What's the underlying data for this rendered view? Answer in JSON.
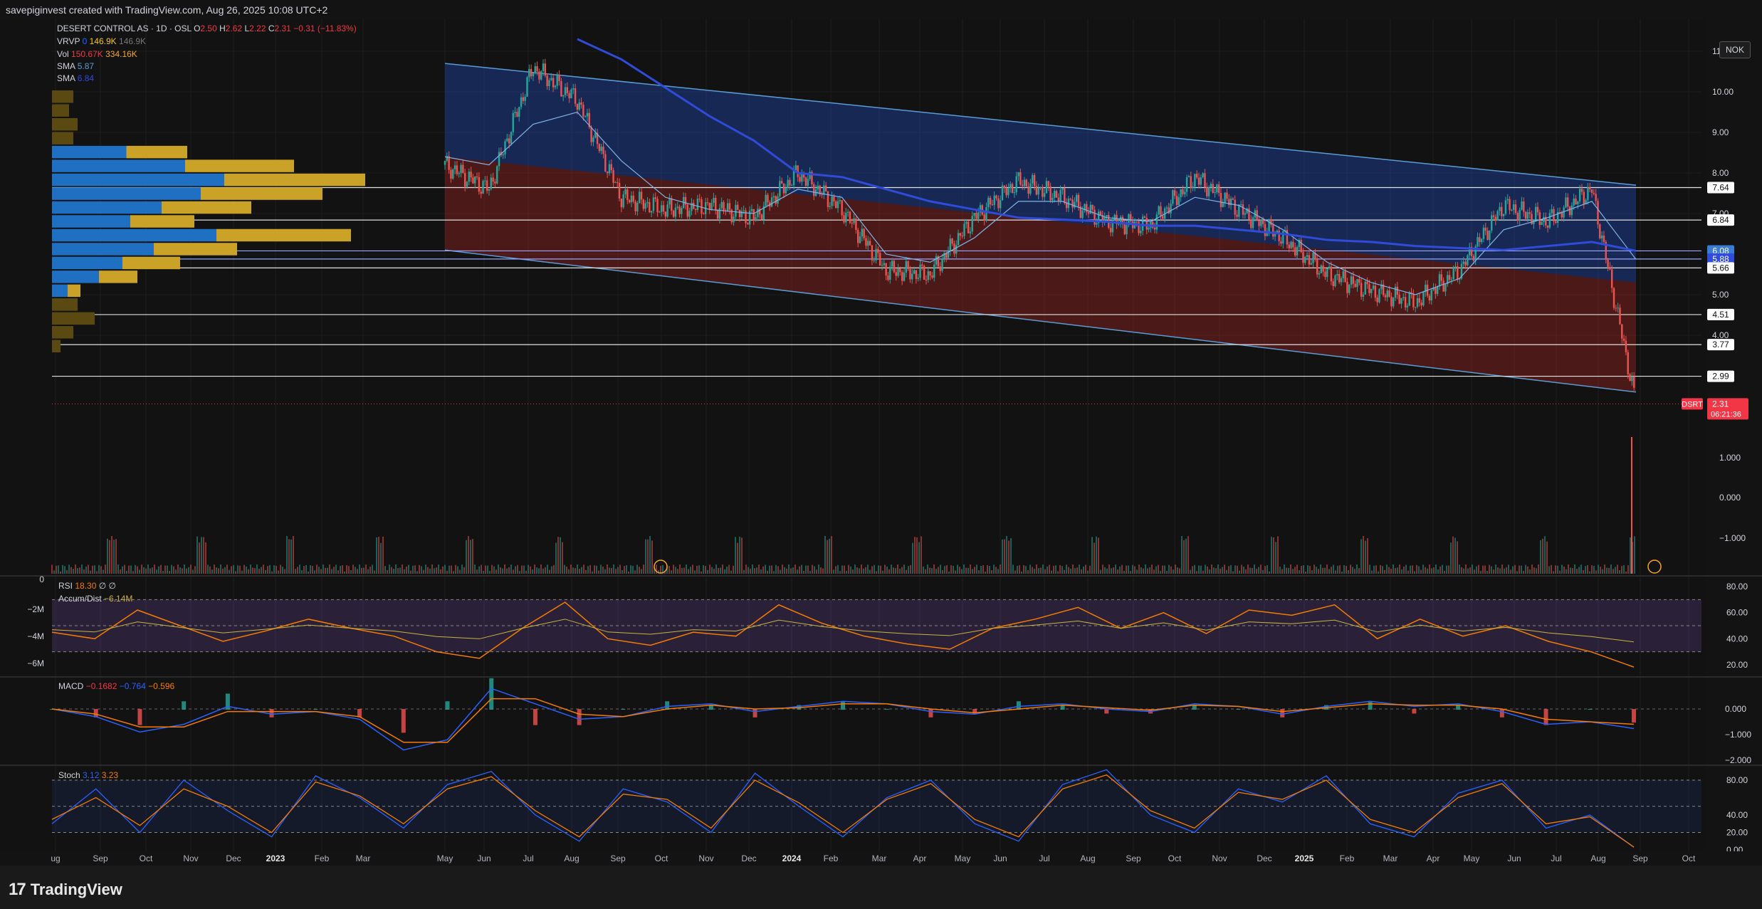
{
  "header": {
    "credit": "savepiginvest created with TradingView.com, Aug 26, 2025 10:08 UTC+2"
  },
  "currency_button": "NOK",
  "footer": {
    "logo_text": "TradingView"
  },
  "legend": {
    "title": "DESERT CONTROL AS · 1D · OSL",
    "ohlc": [
      {
        "k": "O",
        "v": "2.50"
      },
      {
        "k": "H",
        "v": "2.62"
      },
      {
        "k": "L",
        "v": "2.22"
      },
      {
        "k": "C",
        "v": "2.31"
      }
    ],
    "change": "−0.31 (−11.83%)",
    "vrvp": {
      "name": "VRVP",
      "a": "0",
      "b": "146.9K",
      "c": "146.9K"
    },
    "vol": {
      "name": "Vol",
      "a": "150.67K",
      "b": "334.16K"
    },
    "sma1": {
      "name": "SMA",
      "v": "5.87"
    },
    "sma2": {
      "name": "SMA",
      "v": "6.84"
    },
    "rsi": {
      "name": "RSI",
      "a": "18.30",
      "b": "∅",
      "c": "∅"
    },
    "accum": {
      "name": "Accum/Dist",
      "v": "−6.14M"
    },
    "macd": {
      "name": "MACD",
      "a": "−0.1682",
      "b": "−0.764",
      "c": "−0.596"
    },
    "stoch": {
      "name": "Stoch",
      "a": "3.12",
      "b": "3.23"
    }
  },
  "chart_data": [
    {
      "type": "line",
      "title": "DESERT CONTROL AS · 1D · OSL",
      "ticker": "DSRT",
      "last_price": "2.31",
      "countdown": "06:21:36",
      "x_axis_labels": [
        "ug",
        "Sep",
        "Oct",
        "Nov",
        "Dec",
        "2023",
        "Feb",
        "Mar",
        "May",
        "Jun",
        "Jul",
        "Aug",
        "Sep",
        "Oct",
        "Nov",
        "Dec",
        "2024",
        "Feb",
        "Mar",
        "Apr",
        "May",
        "Jun",
        "Jul",
        "Aug",
        "Sep",
        "Oct",
        "Nov",
        "Dec",
        "2025",
        "Feb",
        "Mar",
        "Apr",
        "May",
        "Jun",
        "Jul",
        "Aug",
        "Sep",
        "Oct"
      ],
      "y_ticks": [
        "11.00",
        "10.00",
        "9.00",
        "8.00",
        "7.00",
        "6.00",
        "5.00",
        "4.00"
      ],
      "horizontal_levels": [
        "7.64",
        "6.84",
        "6.08",
        "5.88",
        "5.66",
        "4.51",
        "3.77",
        "2.99"
      ],
      "channel": {
        "upper": [
          10.7,
          7.7
        ],
        "lower": [
          6.1,
          2.6
        ],
        "mid": [
          8.4,
          5.3
        ],
        "from": "2023-05",
        "to": "2025-08"
      },
      "price_series": {
        "x": [
          "2023-05",
          "2023-06",
          "2023-07",
          "2023-08",
          "2023-09",
          "2023-10",
          "2023-11",
          "2023-12",
          "2024-01",
          "2024-02",
          "2024-03",
          "2024-04",
          "2024-05",
          "2024-06",
          "2024-07",
          "2024-08",
          "2024-09",
          "2024-10",
          "2024-11",
          "2024-12",
          "2025-01",
          "2025-02",
          "2025-03",
          "2025-04",
          "2025-05",
          "2025-06",
          "2025-07",
          "2025-08"
        ],
        "close": [
          8.2,
          7.6,
          10.6,
          9.8,
          7.4,
          7.1,
          7.2,
          6.9,
          8.0,
          7.1,
          5.6,
          5.5,
          6.9,
          7.8,
          7.4,
          6.8,
          6.7,
          7.9,
          7.1,
          6.4,
          5.5,
          5.1,
          4.8,
          5.6,
          7.2,
          6.8,
          7.6,
          2.31
        ]
      },
      "sma_fast": [
        8.4,
        8.2,
        9.2,
        9.5,
        8.3,
        7.4,
        7.1,
        7.0,
        7.6,
        7.4,
        6.0,
        5.8,
        6.4,
        7.3,
        7.3,
        6.9,
        6.8,
        7.4,
        7.2,
        6.6,
        5.8,
        5.3,
        5.0,
        5.4,
        6.6,
        6.9,
        7.3,
        5.87
      ],
      "sma_slow": [
        null,
        null,
        null,
        11.3,
        10.8,
        10.1,
        9.4,
        8.8,
        8.0,
        7.9,
        7.6,
        7.3,
        7.1,
        6.9,
        6.85,
        6.8,
        6.7,
        6.7,
        6.6,
        6.5,
        6.35,
        6.3,
        6.2,
        6.15,
        6.1,
        6.2,
        6.3,
        6.08
      ],
      "volume_profile": [
        0.25,
        0.2,
        0.3,
        0.25,
        0.95,
        1.7,
        2.2,
        1.9,
        1.4,
        1.0,
        2.1,
        1.3,
        0.9,
        0.6,
        0.2,
        0.3,
        0.5,
        0.25,
        0.1
      ],
      "volume_axis_ticks": [
        "1.000",
        "0.000",
        "−1.000"
      ]
    },
    {
      "type": "line",
      "title": "RSI",
      "y_ticks": [
        "80.00",
        "60.00",
        "40.00",
        "20.00"
      ],
      "accum_ticks": [
        "0",
        "−2M",
        "−4M",
        "−6M"
      ],
      "values": [
        45,
        40,
        62,
        50,
        38,
        46,
        55,
        48,
        42,
        30,
        25,
        48,
        68,
        40,
        35,
        45,
        42,
        66,
        52,
        42,
        36,
        32,
        48,
        55,
        64,
        48,
        60,
        44,
        62,
        58,
        66,
        40,
        55,
        42,
        50,
        38,
        30,
        18.3
      ]
    },
    {
      "type": "line",
      "title": "MACD",
      "y_ticks": [
        "0.000",
        "−1.000",
        "−2.000"
      ],
      "macd": [
        0.0,
        -0.3,
        -0.9,
        -0.6,
        0.1,
        -0.2,
        -0.1,
        -0.4,
        -1.6,
        -1.2,
        0.8,
        0.2,
        -0.4,
        -0.3,
        0.1,
        0.2,
        -0.1,
        0.1,
        0.3,
        0.2,
        -0.1,
        -0.2,
        0.1,
        0.2,
        0.0,
        -0.1,
        0.2,
        0.1,
        -0.2,
        0.1,
        0.3,
        0.1,
        0.2,
        -0.1,
        -0.6,
        -0.5,
        -0.764
      ],
      "signal": [
        0.0,
        -0.2,
        -0.7,
        -0.7,
        -0.1,
        -0.1,
        -0.1,
        -0.3,
        -1.3,
        -1.3,
        0.4,
        0.4,
        -0.2,
        -0.3,
        0.0,
        0.15,
        0.0,
        0.05,
        0.2,
        0.2,
        0.0,
        -0.15,
        0.0,
        0.15,
        0.05,
        -0.05,
        0.15,
        0.1,
        -0.1,
        0.05,
        0.2,
        0.15,
        0.15,
        0.0,
        -0.4,
        -0.5,
        -0.596
      ]
    },
    {
      "type": "line",
      "title": "Stoch",
      "y_ticks": [
        "80.00",
        "40.00",
        "20.00",
        "0.00"
      ],
      "k": [
        30,
        70,
        20,
        80,
        45,
        15,
        85,
        60,
        25,
        75,
        90,
        40,
        10,
        70,
        55,
        20,
        88,
        50,
        15,
        60,
        80,
        30,
        10,
        75,
        92,
        40,
        20,
        70,
        55,
        85,
        30,
        15,
        65,
        80,
        25,
        40,
        3.12
      ],
      "d": [
        35,
        60,
        28,
        70,
        50,
        20,
        78,
        62,
        30,
        70,
        84,
        45,
        15,
        64,
        58,
        25,
        80,
        54,
        20,
        58,
        76,
        35,
        15,
        70,
        86,
        45,
        25,
        66,
        58,
        80,
        35,
        20,
        60,
        76,
        30,
        38,
        3.23
      ]
    }
  ]
}
